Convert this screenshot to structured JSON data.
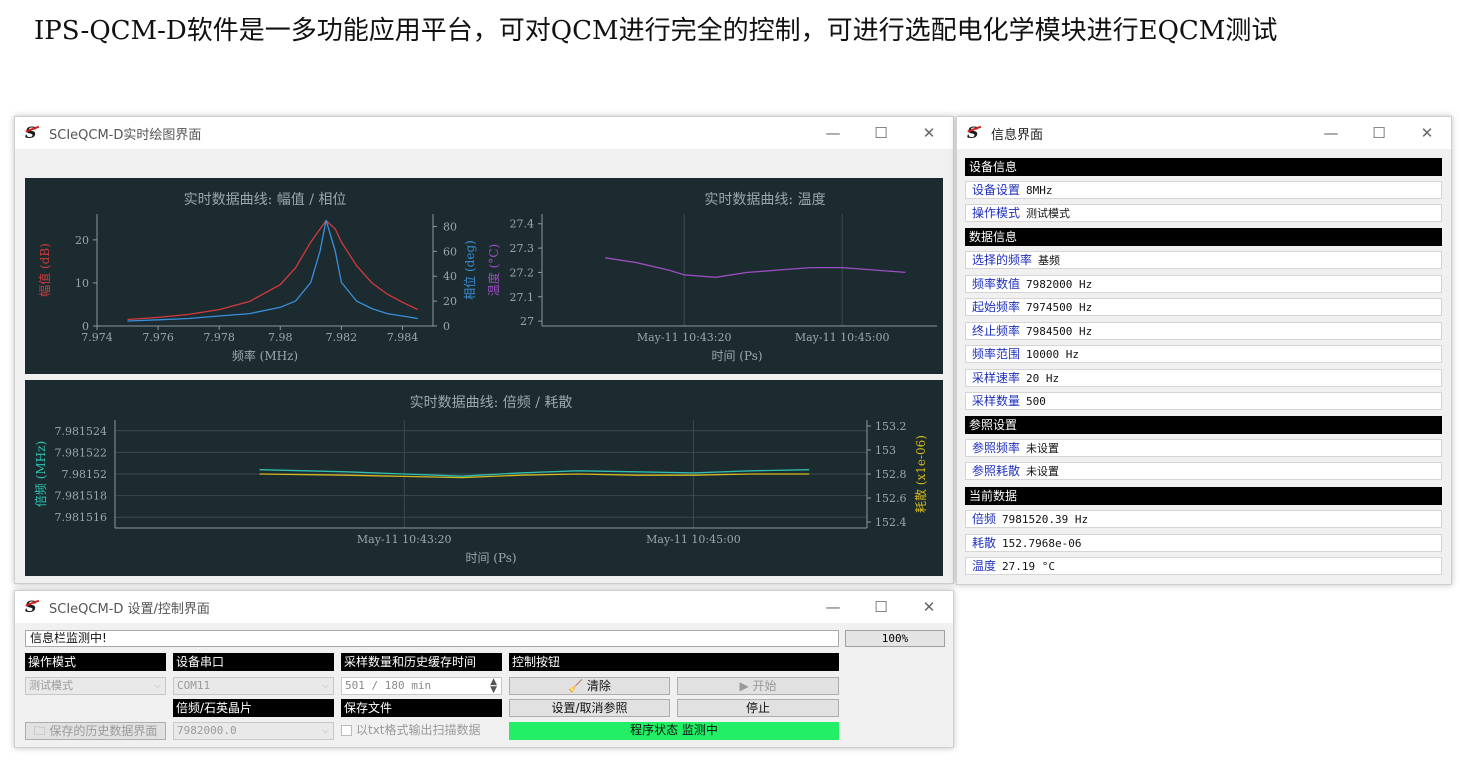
{
  "heading": "IPS-QCM-D软件是一多功能应用平台，可对QCM进行完全的控制，可进行选配电化学模块进行EQCM测试",
  "plot_window": {
    "title": "SCIeQCM-D实时绘图界面",
    "controls": {
      "minimize": "—",
      "maximize": "☐",
      "close": "✕"
    }
  },
  "info_window": {
    "title": "信息界面",
    "controls": {
      "minimize": "—",
      "maximize": "☐",
      "close": "✕"
    },
    "sections": [
      {
        "header": "设备信息",
        "rows": [
          {
            "key": "设备设置",
            "value": "8MHz"
          },
          {
            "key": "操作模式",
            "value": "测试模式"
          }
        ]
      },
      {
        "header": "数据信息",
        "rows": [
          {
            "key": "选择的频率",
            "value": "基频"
          },
          {
            "key": "频率数值",
            "value": "7982000 Hz"
          },
          {
            "key": "起始频率",
            "value": "7974500 Hz"
          },
          {
            "key": "终止频率",
            "value": "7984500 Hz"
          },
          {
            "key": "频率范围",
            "value": "10000 Hz"
          },
          {
            "key": "采样速率",
            "value": "20 Hz"
          },
          {
            "key": "采样数量",
            "value": "500"
          }
        ]
      },
      {
        "header": "参照设置",
        "rows": [
          {
            "key": "参照频率",
            "value": "未设置"
          },
          {
            "key": "参照耗散",
            "value": "未设置"
          }
        ]
      },
      {
        "header": "当前数据",
        "rows": [
          {
            "key": "倍频",
            "value": "7981520.39 Hz"
          },
          {
            "key": "耗散",
            "value": "152.7968e-06"
          },
          {
            "key": "温度",
            "value": "27.19 °C"
          }
        ]
      }
    ]
  },
  "control_window": {
    "title": "SCIeQCM-D 设置/控制界面",
    "controls": {
      "minimize": "—",
      "maximize": "☐",
      "close": "✕"
    },
    "info_bar": "信息栏监测中!",
    "progress": "100%",
    "headers": {
      "mode": "操作模式",
      "port": "设备串口",
      "samples": "采样数量和历史缓存时间",
      "control": "控制按钮",
      "crystal": "倍频/石英晶片",
      "save": "保存文件"
    },
    "mode_value": "测试模式",
    "port_value": "COM11",
    "samples_value": "501 / 180 min",
    "crystal_value": "7982000.0",
    "history_button": "保存的历史数据界面",
    "txt_checkbox": "以txt格式输出扫描数据",
    "clear_button": "清除",
    "start_button": "▶ 开始",
    "reference_button": "设置/取消参照",
    "stop_button": "停止",
    "status_text": "程序状态 监测中",
    "status_color": "#22ee66"
  },
  "chart_data": [
    {
      "type": "line",
      "title": "实时数据曲线: 幅值 / 相位",
      "xlabel": "频率 (MHz)",
      "ylabel": "幅值 (dB)",
      "y2label": "相位 (deg)",
      "x_ticks": [
        "7.974",
        "7.976",
        "7.978",
        "7.98",
        "7.982",
        "7.984"
      ],
      "y_ticks": [
        "0",
        "10",
        "20"
      ],
      "y2_ticks": [
        "0",
        "20",
        "40",
        "60",
        "80"
      ],
      "xlim": [
        7.974,
        7.985
      ],
      "ylim": [
        0,
        26
      ],
      "y2lim": [
        0,
        90
      ],
      "series": [
        {
          "name": "幅值",
          "color": "#d23a3a",
          "axis": "left",
          "x": [
            7.975,
            7.976,
            7.977,
            7.978,
            7.979,
            7.98,
            7.9805,
            7.981,
            7.9813,
            7.9815,
            7.9818,
            7.982,
            7.9825,
            7.983,
            7.9835,
            7.984,
            7.9845
          ],
          "values": [
            1.5,
            2.0,
            2.7,
            3.8,
            5.7,
            9.6,
            13.5,
            19.5,
            22.5,
            24.5,
            22.5,
            19.5,
            14.0,
            10.0,
            7.4,
            5.5,
            3.8
          ]
        },
        {
          "name": "相位",
          "color": "#3a8fd8",
          "axis": "right",
          "x": [
            7.975,
            7.976,
            7.977,
            7.978,
            7.979,
            7.98,
            7.9805,
            7.981,
            7.9813,
            7.9815,
            7.9818,
            7.982,
            7.9825,
            7.983,
            7.9835,
            7.984,
            7.9845
          ],
          "values": [
            4,
            5,
            6,
            8,
            10,
            15,
            20,
            35,
            60,
            85,
            60,
            35,
            20,
            14,
            10,
            8,
            6
          ]
        }
      ]
    },
    {
      "type": "line",
      "title": "实时数据曲线: 温度",
      "xlabel": "时间 (Ps)",
      "ylabel": "温度 (°C)",
      "x_ticks": [
        "May-11 10:43:20",
        "May-11 10:45:00"
      ],
      "y_ticks": [
        "27",
        "27.1",
        "27.2",
        "27.3",
        "27.4"
      ],
      "ylim": [
        26.98,
        27.44
      ],
      "series": [
        {
          "name": "温度",
          "color": "#9a4fc0",
          "x": [
            "10:42:30",
            "10:42:50",
            "10:43:10",
            "10:43:20",
            "10:43:40",
            "10:44:00",
            "10:44:20",
            "10:44:40",
            "10:45:00",
            "10:45:20",
            "10:45:40"
          ],
          "values": [
            27.26,
            27.24,
            27.21,
            27.19,
            27.18,
            27.2,
            27.21,
            27.22,
            27.22,
            27.21,
            27.2
          ]
        }
      ]
    },
    {
      "type": "line",
      "title": "实时数据曲线: 倍频 / 耗散",
      "xlabel": "时间 (Ps)",
      "ylabel": "倍频 (MHz)",
      "y2label": "耗散 (x1e-06)",
      "x_ticks": [
        "May-11 10:43:20",
        "May-11 10:45:00"
      ],
      "y_ticks": [
        "7.981516",
        "7.981518",
        "7.98152",
        "7.981522",
        "7.981524"
      ],
      "y2_ticks": [
        "152.4",
        "152.6",
        "152.8",
        "153",
        "153.2"
      ],
      "ylim": [
        7.981515,
        7.981525
      ],
      "y2lim": [
        152.35,
        153.25
      ],
      "series": [
        {
          "name": "倍频",
          "color": "#30c0b0",
          "axis": "left",
          "x": [
            "10:42:30",
            "10:43:00",
            "10:43:20",
            "10:43:40",
            "10:44:00",
            "10:44:20",
            "10:44:40",
            "10:45:00",
            "10:45:20",
            "10:45:40"
          ],
          "values": [
            7.9815204,
            7.9815202,
            7.98152,
            7.9815198,
            7.9815201,
            7.9815203,
            7.9815202,
            7.9815201,
            7.9815203,
            7.9815204
          ]
        },
        {
          "name": "耗散",
          "color": "#d4b820",
          "axis": "right",
          "x": [
            "10:42:30",
            "10:43:00",
            "10:43:20",
            "10:43:40",
            "10:44:00",
            "10:44:20",
            "10:44:40",
            "10:45:00",
            "10:45:20",
            "10:45:40"
          ],
          "values": [
            152.8,
            152.79,
            152.78,
            152.77,
            152.79,
            152.8,
            152.79,
            152.79,
            152.8,
            152.8
          ]
        }
      ]
    }
  ]
}
